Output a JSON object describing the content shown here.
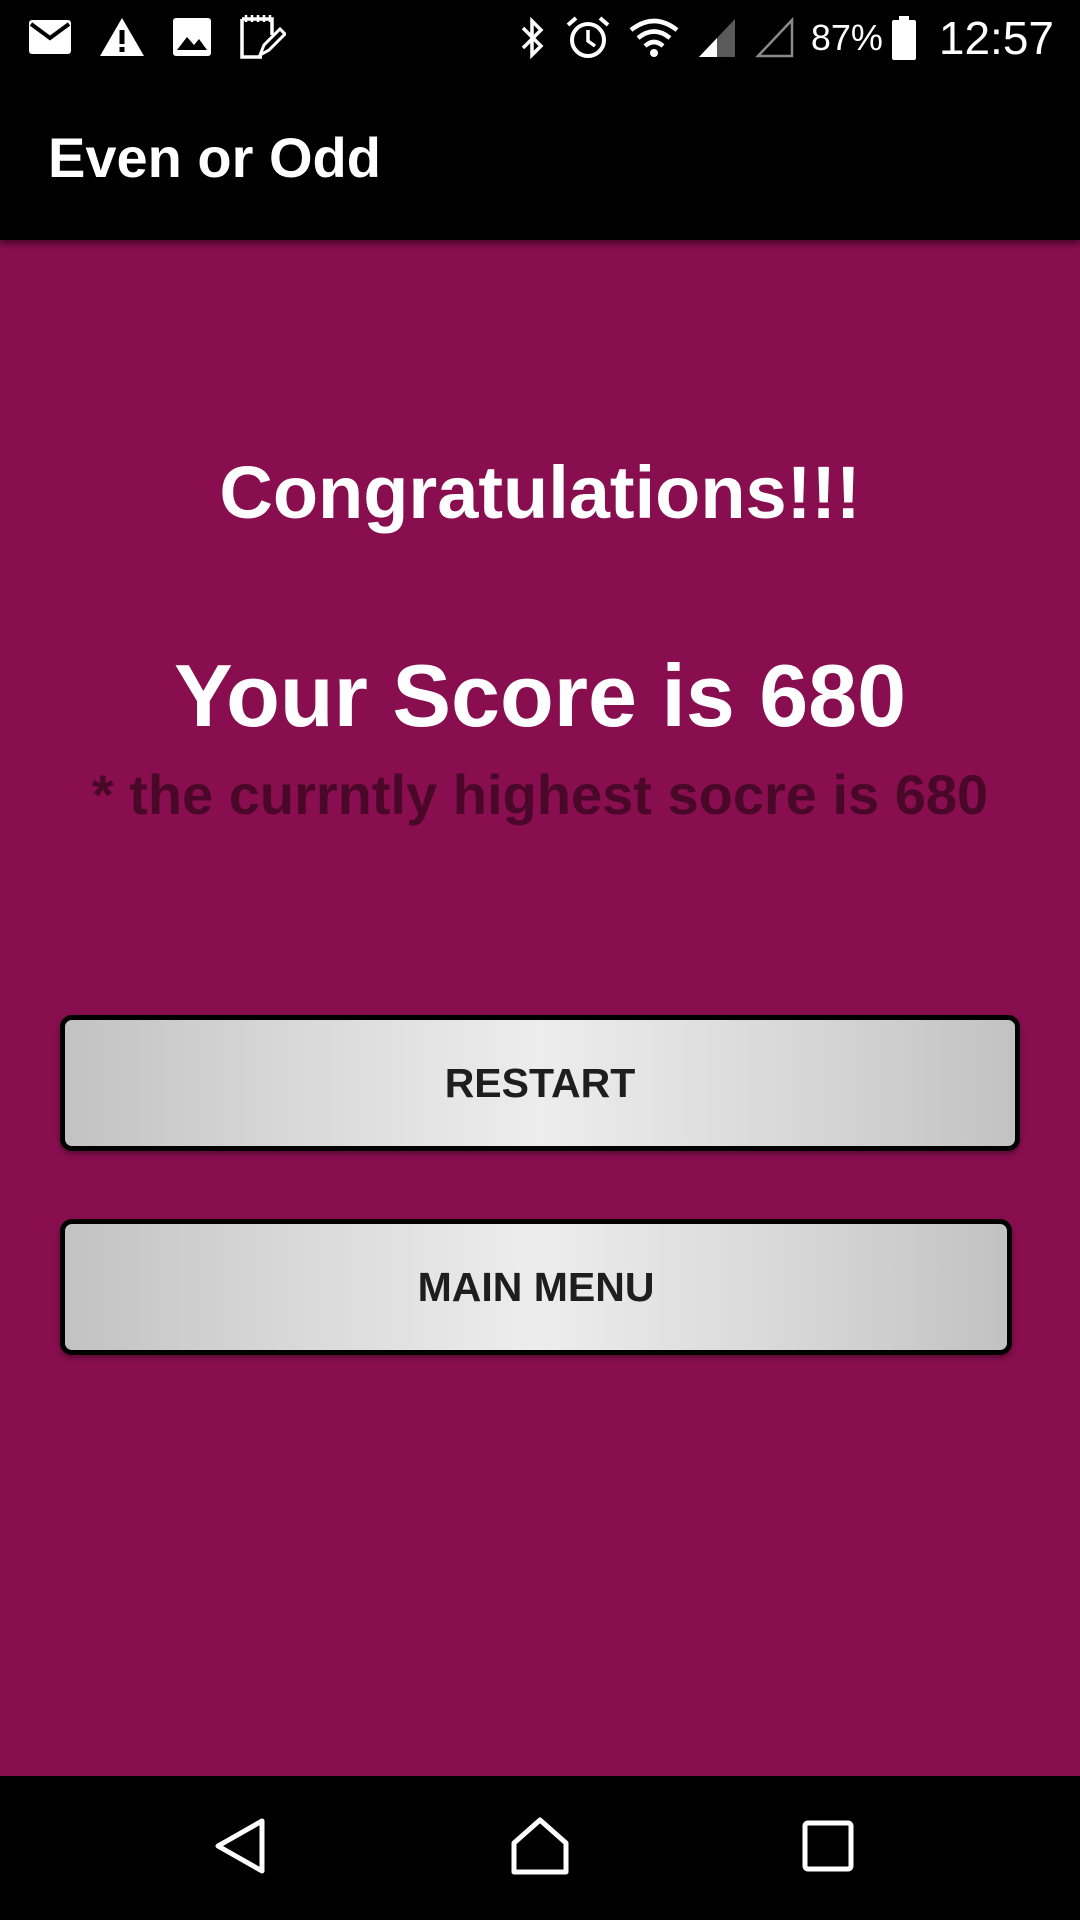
{
  "status_bar": {
    "left_icons": [
      "mail-icon",
      "warning-icon",
      "image-icon",
      "notes-icon"
    ],
    "right_icons": [
      "bluetooth-icon",
      "alarm-icon",
      "wifi-icon",
      "cell-signal-icon",
      "no-signal-icon",
      "battery-icon"
    ],
    "battery_percent": "87%",
    "time": "12:57"
  },
  "app_bar": {
    "title": "Even or Odd"
  },
  "result": {
    "congrats": "Congratulations!!!",
    "score_text": "Your Score is 680",
    "highest_text": "* the currntly highest socre is 680"
  },
  "buttons": {
    "restart_label": "RESTART",
    "main_menu_label": "MAIN MENU"
  },
  "nav_bar": {
    "icons": [
      "back-icon",
      "home-icon",
      "recents-icon"
    ]
  },
  "colors": {
    "background": "#880e4f",
    "bars": "#000000",
    "highest_text": "#4a0828",
    "button_text": "#1e1e1e"
  }
}
